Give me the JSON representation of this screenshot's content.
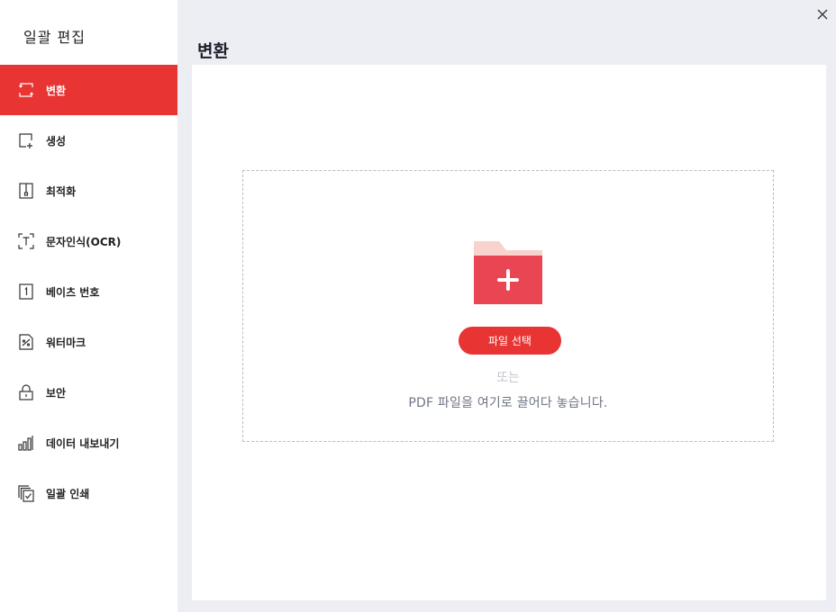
{
  "sidebar": {
    "title": "일괄 편집",
    "items": [
      {
        "label": "변환",
        "icon": "convert-icon",
        "active": true
      },
      {
        "label": "생성",
        "icon": "create-icon",
        "active": false
      },
      {
        "label": "최적화",
        "icon": "optimize-icon",
        "active": false
      },
      {
        "label": "문자인식(OCR)",
        "icon": "ocr-icon",
        "active": false
      },
      {
        "label": "베이츠 번호",
        "icon": "bates-number-icon",
        "active": false
      },
      {
        "label": "워터마크",
        "icon": "watermark-icon",
        "active": false
      },
      {
        "label": "보안",
        "icon": "lock-icon",
        "active": false
      },
      {
        "label": "데이터 내보내기",
        "icon": "bar-chart-icon",
        "active": false
      },
      {
        "label": "일괄 인쇄",
        "icon": "print-icon",
        "active": false
      }
    ]
  },
  "main": {
    "title": "변환",
    "dropzone": {
      "icon": "folder-add-icon",
      "button_label": "파일 선택",
      "or_text": "또는",
      "hint": "PDF 파일을 여기로 끌어다 놓습니다."
    }
  },
  "window": {
    "close_icon": "close-icon"
  },
  "colors": {
    "accent": "#e93434",
    "background": "#eceef3",
    "panel": "#ffffff",
    "folder_front": "#ea4552",
    "folder_back": "#f8d2cd"
  }
}
